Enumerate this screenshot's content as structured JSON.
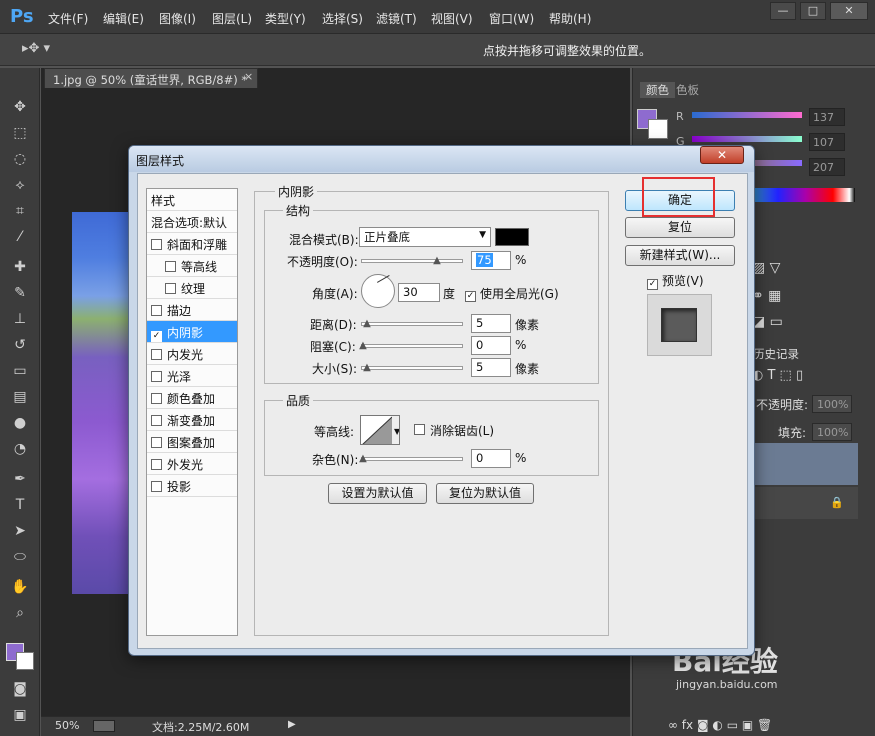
{
  "app": {
    "logo": "Ps",
    "menus": [
      "文件(F)",
      "编辑(E)",
      "图像(I)",
      "图层(L)",
      "类型(Y)",
      "选择(S)",
      "滤镜(T)",
      "视图(V)",
      "窗口(W)",
      "帮助(H)"
    ],
    "window_buttons": [
      "—",
      "□",
      "✕"
    ]
  },
  "options_bar": {
    "hint": "点按并拖移可调整效果的位置。"
  },
  "document": {
    "tab_title": "1.jpg @ 50% (童话世界, RGB/8#) *",
    "tab_close": "×",
    "zoom": "50%",
    "doc_info": "文档:2.25M/2.60M"
  },
  "panels": {
    "color_tabs": [
      "颜色",
      "色板"
    ],
    "rgb": [
      {
        "label": "R",
        "value": "137"
      },
      {
        "label": "G",
        "value": "107"
      },
      {
        "label": "B",
        "value": "207"
      }
    ],
    "history_tab": "历史记录",
    "opacity_label": "不透明度:",
    "opacity_value": "100%",
    "fill_label": "填充:",
    "fill_value": "100%",
    "foreground_color": "#8e6bcf"
  },
  "dialog": {
    "title": "图层样式",
    "close": "✕",
    "styles_header": "样式",
    "styles": [
      {
        "label": "混合选项:默认",
        "checkbox": false,
        "checked": false,
        "indent": false,
        "selected": false
      },
      {
        "label": "斜面和浮雕",
        "checkbox": true,
        "checked": false,
        "indent": false,
        "selected": false
      },
      {
        "label": "等高线",
        "checkbox": true,
        "checked": false,
        "indent": true,
        "selected": false
      },
      {
        "label": "纹理",
        "checkbox": true,
        "checked": false,
        "indent": true,
        "selected": false
      },
      {
        "label": "描边",
        "checkbox": true,
        "checked": false,
        "indent": false,
        "selected": false
      },
      {
        "label": "内阴影",
        "checkbox": true,
        "checked": true,
        "indent": false,
        "selected": true
      },
      {
        "label": "内发光",
        "checkbox": true,
        "checked": false,
        "indent": false,
        "selected": false
      },
      {
        "label": "光泽",
        "checkbox": true,
        "checked": false,
        "indent": false,
        "selected": false
      },
      {
        "label": "颜色叠加",
        "checkbox": true,
        "checked": false,
        "indent": false,
        "selected": false
      },
      {
        "label": "渐变叠加",
        "checkbox": true,
        "checked": false,
        "indent": false,
        "selected": false
      },
      {
        "label": "图案叠加",
        "checkbox": true,
        "checked": false,
        "indent": false,
        "selected": false
      },
      {
        "label": "外发光",
        "checkbox": true,
        "checked": false,
        "indent": false,
        "selected": false
      },
      {
        "label": "投影",
        "checkbox": true,
        "checked": false,
        "indent": false,
        "selected": false
      }
    ],
    "section_title": "内阴影",
    "structure": {
      "title": "结构",
      "blend_mode_label": "混合模式(B):",
      "blend_mode_value": "正片叠底",
      "shadow_color": "#000000",
      "opacity_label": "不透明度(O):",
      "opacity_value": "75",
      "opacity_unit": "%",
      "angle_label": "角度(A):",
      "angle_value": "30",
      "angle_unit": "度",
      "global_light_label": "使用全局光(G)",
      "global_light_checked": true,
      "distance_label": "距离(D):",
      "distance_value": "5",
      "distance_unit": "像素",
      "choke_label": "阻塞(C):",
      "choke_value": "0",
      "choke_unit": "%",
      "size_label": "大小(S):",
      "size_value": "5",
      "size_unit": "像素"
    },
    "quality": {
      "title": "品质",
      "contour_label": "等高线:",
      "antialias_label": "消除锯齿(L)",
      "antialias_checked": false,
      "noise_label": "杂色(N):",
      "noise_value": "0",
      "noise_unit": "%"
    },
    "buttons": {
      "make_default": "设置为默认值",
      "reset_default": "复位为默认值",
      "ok": "确定",
      "reset": "复位",
      "new_style": "新建样式(W)...",
      "preview_label": "预览(V)",
      "preview_checked": true
    }
  },
  "watermark": {
    "text": "Bai经验",
    "url": "jingyan.baidu.com"
  }
}
